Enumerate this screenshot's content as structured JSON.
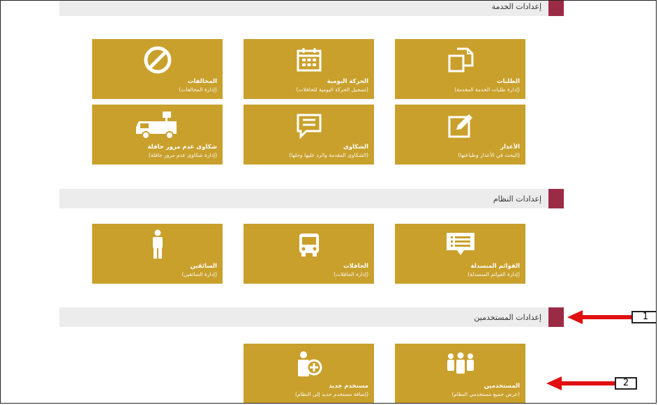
{
  "sections": {
    "service": {
      "title": "إعدادات الخدمة"
    },
    "system": {
      "title": "إعدادات النظام"
    },
    "users": {
      "title": "إعدادات المستخدمين"
    }
  },
  "tiles": {
    "violations": {
      "label": "المخالفات",
      "sub": "(إدارة المخالفات)",
      "icon": "prohibited-icon"
    },
    "daily": {
      "label": "الحركة اليومية",
      "sub": "(تسجيل الحركة اليومية للحافلات)",
      "icon": "calendar-icon"
    },
    "requests": {
      "label": "الطلبات",
      "sub": "(إدارة طلبات الخدمة المقدمة)",
      "icon": "documents-icon"
    },
    "bus_complaints": {
      "label": "شكاوى عدم مرور حافلة",
      "sub": "(إدارة شكاوى عدم مرور حافلة)",
      "icon": "truck-icon"
    },
    "complaints": {
      "label": "الشكاوى",
      "sub": "(الشكاوى المقدمة والرد عليها وحلها)",
      "icon": "chat-icon"
    },
    "excuses": {
      "label": "الأعذار",
      "sub": "(البحث في الأعذار وطباعتها)",
      "icon": "edit-icon"
    },
    "drivers": {
      "label": "السائقين",
      "sub": "(إدارة السائقين)",
      "icon": "person-icon"
    },
    "buses": {
      "label": "الحافلات",
      "sub": "(إدارة الحافلات)",
      "icon": "bus-icon"
    },
    "dropdowns": {
      "label": "القوائم المنسدلة",
      "sub": "(إدارة القوائم المنسدلة)",
      "icon": "list-icon"
    },
    "new_user": {
      "label": "مستخدم جديد",
      "sub": "(إضافة مستخدم جديد إلى النظام)",
      "icon": "add-user-icon"
    },
    "users": {
      "label": "المستخدمين",
      "sub": "(عرض جميع مستخدمي النظام)",
      "icon": "group-icon"
    }
  },
  "callouts": {
    "one": "1",
    "two": "2"
  },
  "colors": {
    "tile": "#c9a02c",
    "marker": "#9b2b45",
    "arrow": "#e01010"
  }
}
